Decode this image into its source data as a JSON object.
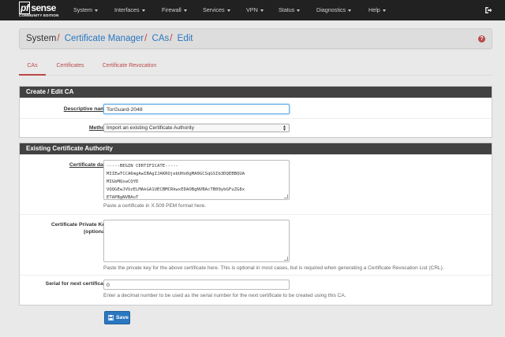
{
  "navbar": {
    "logo_main": "sense",
    "logo_prefix": "pf",
    "logo_edition": "COMMUNITY EDITION",
    "menu": [
      {
        "label": "System"
      },
      {
        "label": "Interfaces"
      },
      {
        "label": "Firewall"
      },
      {
        "label": "Services"
      },
      {
        "label": "VPN"
      },
      {
        "label": "Status"
      },
      {
        "label": "Diagnostics"
      },
      {
        "label": "Help"
      }
    ],
    "logout_icon": "sign-out-icon"
  },
  "breadcrumb": {
    "root": "System",
    "items": [
      "Certificate Manager",
      "CAs",
      "Edit"
    ],
    "separator": "/",
    "help_icon": "question-circle-icon"
  },
  "tabs": [
    {
      "label": "CAs",
      "active": true
    },
    {
      "label": "Certificates",
      "active": false
    },
    {
      "label": "Certificate Revocation",
      "active": false
    }
  ],
  "create_panel": {
    "heading": "Create / Edit CA",
    "descriptive_name": {
      "label": "Descriptive name",
      "value": "TorGuard-2048"
    },
    "method": {
      "label": "Method",
      "selected": "Import an existing Certificate Authority"
    }
  },
  "existing_panel": {
    "heading": "Existing Certificate Authority",
    "certificate_data": {
      "label": "Certificate data",
      "lines": [
        "-----BEGIN CERTIFICATE-----",
        "MIIEwTCCA6mgAwIBAgIJAKROjebUHo0gMA0GCSqGSIb3DQEBBQUA",
        "MIGbMQswCQYD",
        "VQQGEwJVUzELMAkGA1UECBMCRkwxEDAOBgNVBAcTB09ybGFuZG8x",
        "ETAPBgNVBAoT"
      ],
      "help": "Paste a certificate in X.509 PEM format here."
    },
    "private_key": {
      "label_line1": "Certificate Private Key",
      "label_line2": "(optional)",
      "value": "",
      "help": "Paste the private key for the above certificate here. This is optional in most cases, but is required when generating a Certificate Revocation List (CRL)."
    },
    "serial": {
      "label": "Serial for next certificate",
      "value": "0",
      "help": "Enter a decimal number to be used as the serial number for the next certificate to be created using this CA."
    }
  },
  "save_button": {
    "label": "Save",
    "icon": "save-icon"
  },
  "colors": {
    "accent": "#b94a48",
    "link": "#2a77c0",
    "navbar": "#212121",
    "panel_heading": "#424242"
  }
}
